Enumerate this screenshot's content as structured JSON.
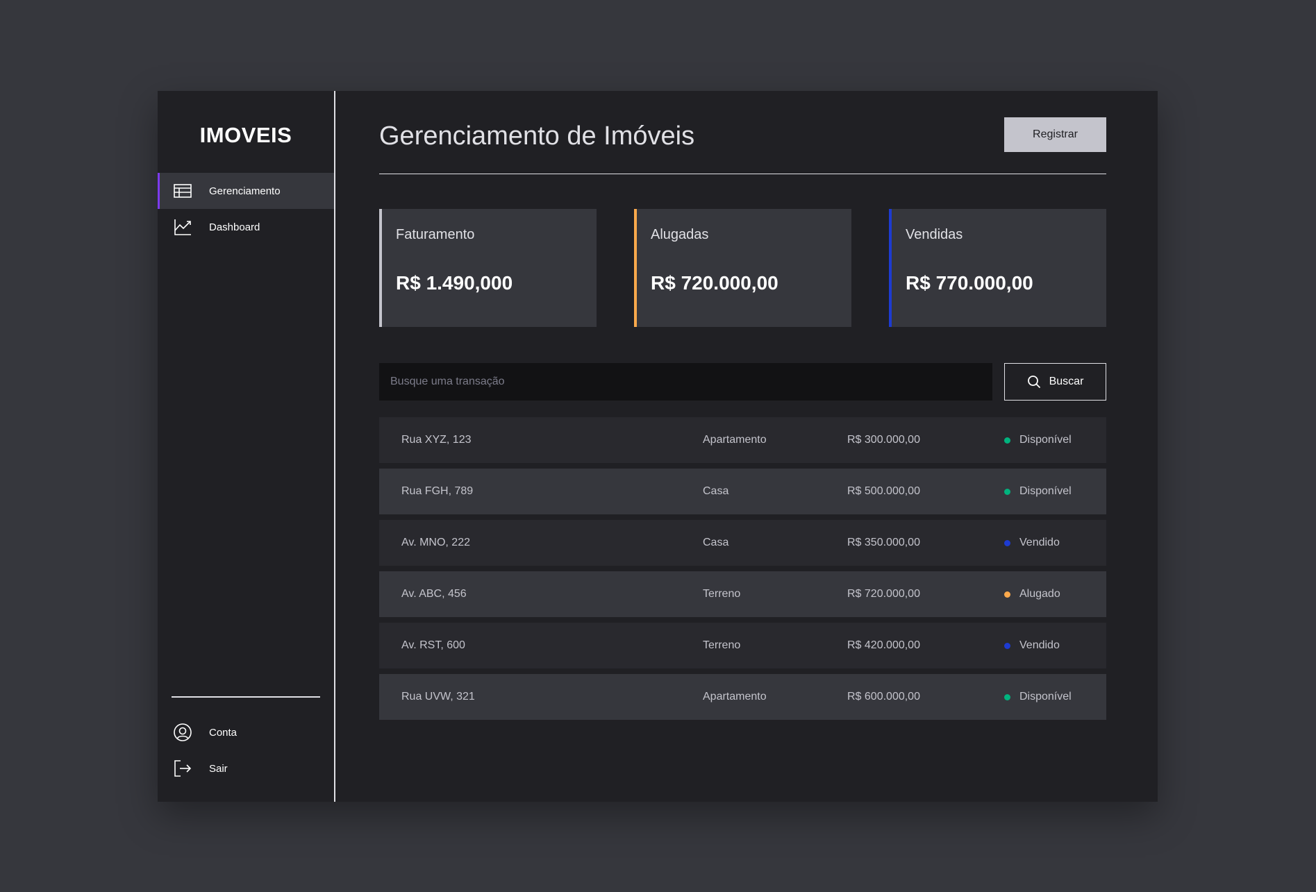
{
  "app": {
    "logo": "IMOVEIS"
  },
  "sidebar": {
    "items": [
      {
        "label": "Gerenciamento",
        "icon": "table-icon",
        "active": true
      },
      {
        "label": "Dashboard",
        "icon": "chart-line-icon",
        "active": false
      }
    ],
    "bottom_items": [
      {
        "label": "Conta",
        "icon": "user-circle-icon"
      },
      {
        "label": "Sair",
        "icon": "sign-out-icon"
      }
    ]
  },
  "header": {
    "title": "Gerenciamento de Imóveis",
    "register_label": "Registrar"
  },
  "cards": [
    {
      "title": "Faturamento",
      "value": "R$ 1.490,000",
      "accent": "#c4c4cc"
    },
    {
      "title": "Alugadas",
      "value": "R$ 720.000,00",
      "accent": "#fba94c"
    },
    {
      "title": "Vendidas",
      "value": "R$ 770.000,00",
      "accent": "#1d3bd1"
    }
  ],
  "search": {
    "placeholder": "Busque uma transação",
    "value": "",
    "button_label": "Buscar"
  },
  "status_colors": {
    "Disponível": "#00b37e",
    "Vendido": "#1d3bd1",
    "Alugado": "#fba94c"
  },
  "properties": [
    {
      "address": "Rua XYZ, 123",
      "type": "Apartamento",
      "price": "R$ 300.000,00",
      "status": "Disponível"
    },
    {
      "address": "Rua FGH, 789",
      "type": "Casa",
      "price": "R$ 500.000,00",
      "status": "Disponível"
    },
    {
      "address": "Av. MNO, 222",
      "type": "Casa",
      "price": "R$ 350.000,00",
      "status": "Vendido"
    },
    {
      "address": "Av. ABC, 456",
      "type": "Terreno",
      "price": "R$ 720.000,00",
      "status": "Alugado"
    },
    {
      "address": "Av. RST, 600",
      "type": "Terreno",
      "price": "R$ 420.000,00",
      "status": "Vendido"
    },
    {
      "address": "Rua UVW, 321",
      "type": "Apartamento",
      "price": "R$ 600.000,00",
      "status": "Disponível"
    }
  ]
}
